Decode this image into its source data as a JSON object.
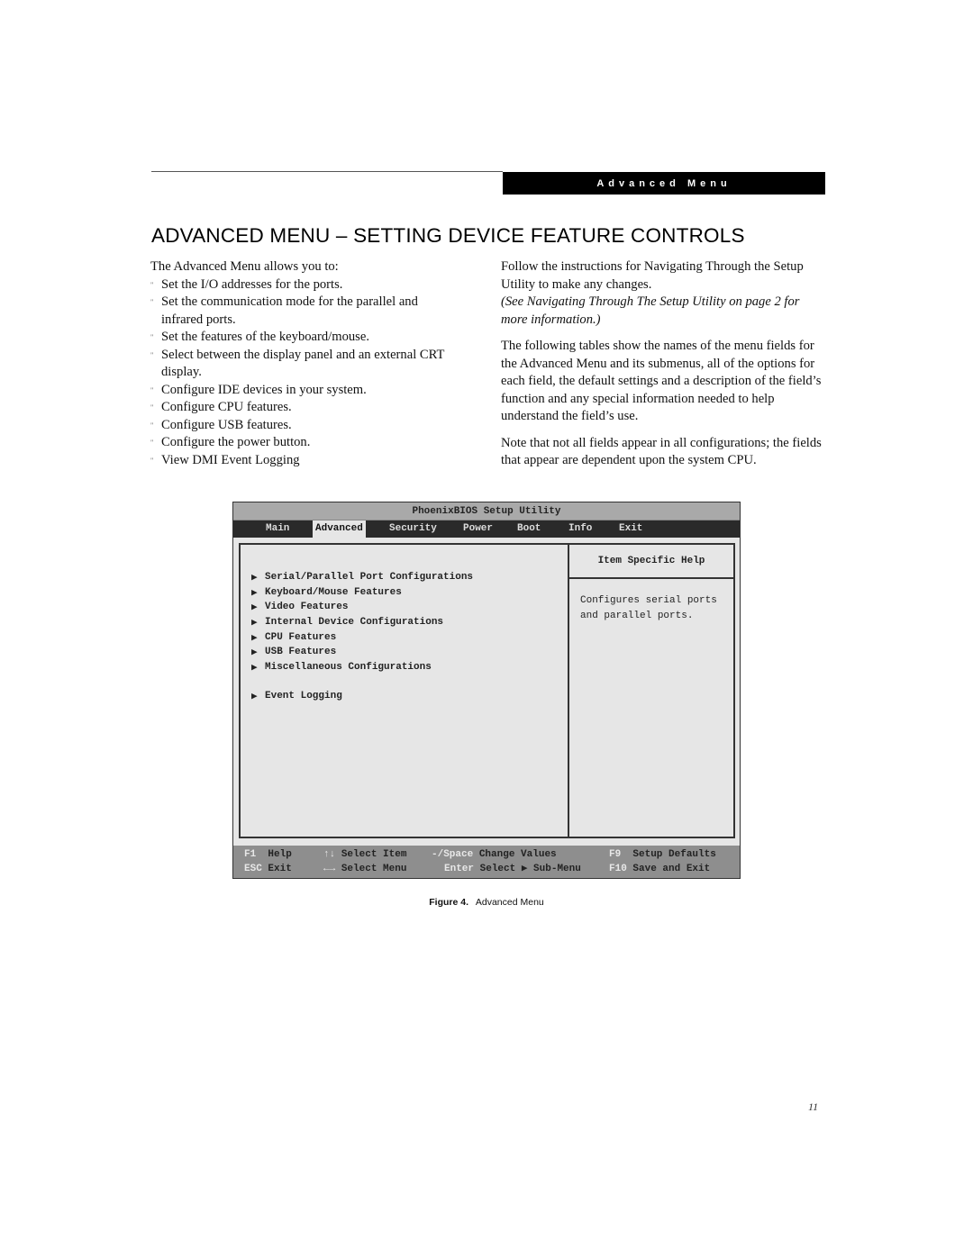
{
  "header": {
    "section_label": "Advanced Menu"
  },
  "page_title": "ADVANCED MENU – SETTING DEVICE FEATURE CONTROLS",
  "left_column": {
    "intro": "The Advanced Menu allows you to:",
    "bullet_glyph": "\"",
    "bullets": [
      "Set the I/O addresses for the ports.",
      "Set the communication mode for the parallel and infrared ports.",
      "Set the features of the keyboard/mouse.",
      "Select between the display panel and an external CRT display.",
      "Configure IDE devices in your system.",
      "Configure CPU features.",
      "Configure USB features.",
      "Configure the power button.",
      "View DMI Event Logging"
    ]
  },
  "right_column": {
    "p1": "Follow the instructions for Navigating Through the Setup Utility to make any changes.",
    "p1_italic": "(See Navigating Through The Setup Utility on page 2 for more information.)",
    "p2": "The following tables show the names of the menu fields for the Advanced Menu and its submenus, all of the options for each field, the default settings and a description of the field’s function and any special information needed to help understand the field’s use.",
    "p3": "Note that not all fields appear in all configurations; the fields that appear are dependent upon the system CPU."
  },
  "bios": {
    "title": "PhoenixBIOS Setup Utility",
    "tabs": [
      {
        "label": "Main",
        "active": false
      },
      {
        "label": "Advanced",
        "active": true
      },
      {
        "label": "Security",
        "active": false
      },
      {
        "label": "Power",
        "active": false
      },
      {
        "label": "Boot",
        "active": false
      },
      {
        "label": "Info",
        "active": false
      },
      {
        "label": "Exit",
        "active": false
      }
    ],
    "submenu_arrow": "▶",
    "items": [
      "Serial/Parallel Port Configurations",
      "Keyboard/Mouse Features",
      "Video Features",
      "Internal Device Configurations",
      "CPU Features",
      "USB Features",
      "Miscellaneous Configurations",
      "Event Logging"
    ],
    "help_header": "Item Specific Help",
    "help_text": "Configures serial ports and parallel ports.",
    "footer": [
      {
        "key": "F1",
        "action": "Help"
      },
      {
        "key": "ESC",
        "action": "Exit"
      },
      {
        "key": "↑↓",
        "action": "Select Item"
      },
      {
        "key": "←→",
        "action": "Select Menu"
      },
      {
        "key": "-/Space",
        "action": "Change Values"
      },
      {
        "key": "Enter",
        "action": "Select ▶ Sub-Menu"
      },
      {
        "key": "F9",
        "action": "Setup Defaults"
      },
      {
        "key": "F10",
        "action": "Save and Exit"
      }
    ]
  },
  "figure_caption": {
    "label": "Figure 4.",
    "title": "Advanced Menu"
  },
  "page_number": "11"
}
